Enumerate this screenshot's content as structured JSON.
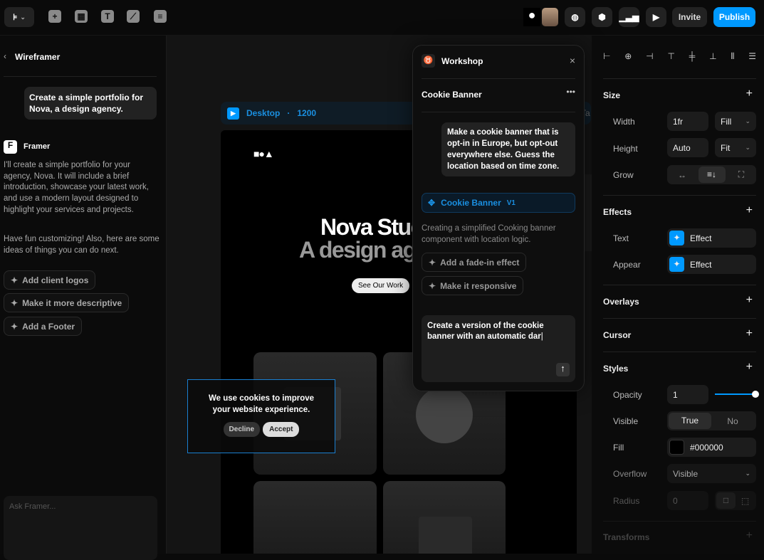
{
  "topbar": {
    "invite": "Invite",
    "publish": "Publish",
    "accent": "#0099ff"
  },
  "left": {
    "back_title": "Wireframer",
    "user_msg": "Create a simple portfolio for Nova, a design agency.",
    "bot_name": "Framer",
    "bot_msg1": "I'll create a simple portfolio for your agency, Nova. It will include a brief introduction, showcase your latest work, and use a modern layout designed to highlight your services and projects.",
    "bot_msg2": "Have fun customizing! Also, here are some ideas of things you can do next.",
    "suggestions": [
      "Add client logos",
      "Make it more descriptive",
      "Add a Footer"
    ],
    "input_placeholder": "Ask Framer..."
  },
  "canvas": {
    "breakpoint": "Desktop",
    "width": "1200",
    "hero_title": "Nova Studio",
    "hero_sub": "A design agency",
    "cta": "See Our Work",
    "cookie_text": "We use cookies to improve your website experience.",
    "decline": "Decline",
    "accept": "Accept",
    "peek_label": "Ta"
  },
  "workshop": {
    "title": "Workshop",
    "component": "Cookie Banner",
    "user_msg": "Make a cookie banner that is opt-in in Europe, but opt-out everywhere else. Guess the location based on time zone.",
    "result_name": "Cookie Banner",
    "result_version": "V1",
    "status": "Creating a simplified Cooking banner component with location logic.",
    "suggestions": [
      "Add a fade-in effect",
      "Make it responsive"
    ],
    "input_value": "Create a version of the cookie banner with an automatic dar"
  },
  "props": {
    "size": {
      "title": "Size",
      "width_label": "Width",
      "width": "1fr",
      "width_mode": "Fill",
      "height_label": "Height",
      "height": "Auto",
      "height_mode": "Fit",
      "grow_label": "Grow"
    },
    "effects": {
      "title": "Effects",
      "text_label": "Text",
      "text_value": "Effect",
      "appear_label": "Appear",
      "appear_value": "Effect"
    },
    "overlays": "Overlays",
    "cursor": "Cursor",
    "styles": {
      "title": "Styles",
      "opacity_label": "Opacity",
      "opacity": "1",
      "opacity_fraction": 1.0,
      "visible_label": "Visible",
      "visible_true": "True",
      "visible_no": "No",
      "fill_label": "Fill",
      "fill": "#000000",
      "overflow_label": "Overflow",
      "overflow": "Visible",
      "radius_label": "Radius",
      "radius": "0"
    },
    "transforms": "Transforms"
  }
}
